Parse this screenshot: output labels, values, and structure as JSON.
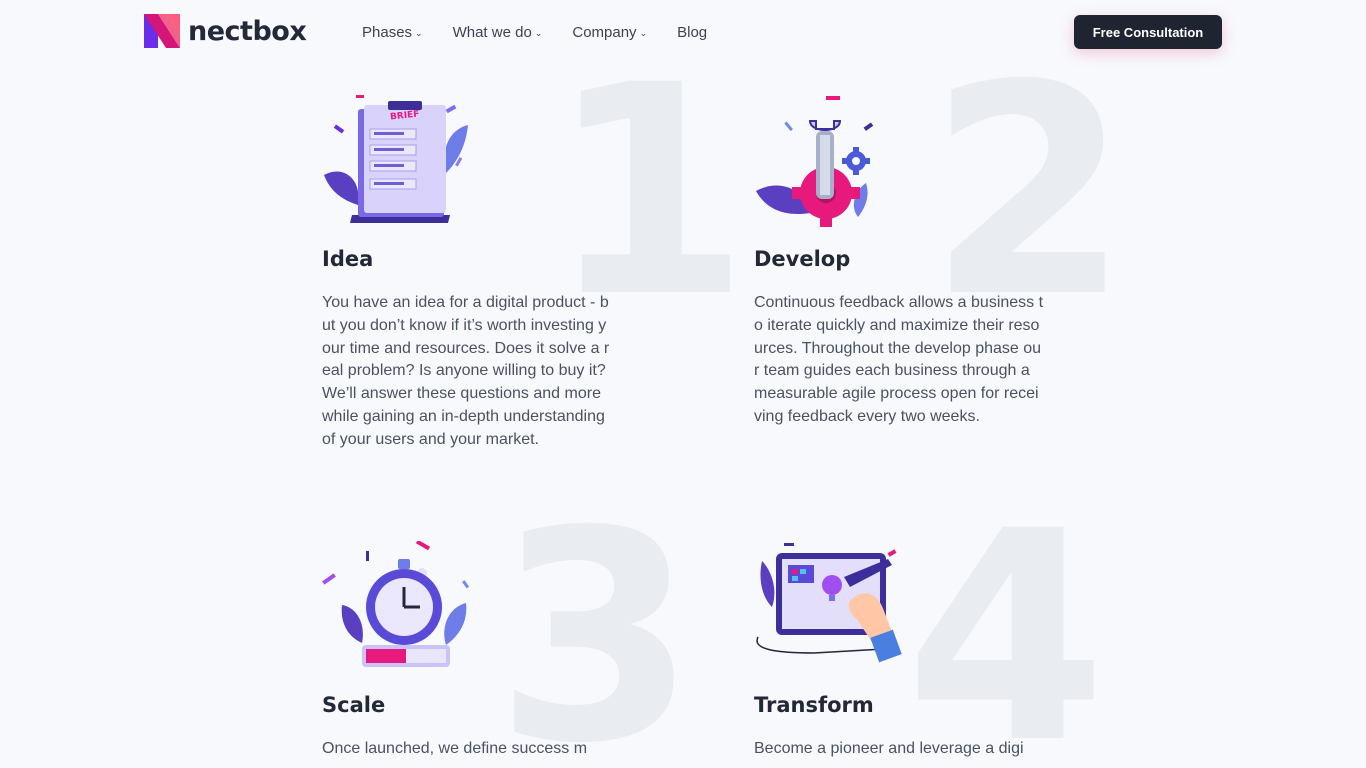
{
  "header": {
    "logo_text": "nectbox",
    "nav": [
      {
        "label": "Phases",
        "has_dropdown": true
      },
      {
        "label": "What we do",
        "has_dropdown": true
      },
      {
        "label": "Company",
        "has_dropdown": true
      },
      {
        "label": "Blog",
        "has_dropdown": false
      }
    ],
    "cta_label": "Free Consultation",
    "chevron_glyph": "⌄"
  },
  "phases": [
    {
      "number": "1",
      "title": "Idea",
      "icon": "brief-document-icon",
      "illus_label": "BRIEF",
      "text": "You have an idea for a digital product - but you don’t know if it’s worth investing your time and resources. Does it solve a real problem? Is anyone willing to buy it? We’ll answer these questions and more while gaining an in-depth understanding of your users and your market."
    },
    {
      "number": "2",
      "title": "Develop",
      "icon": "wrench-gear-icon",
      "text": "Continuous feedback allows a business to iterate quickly and maximize their resources. Throughout the develop phase our team guides each business through a measurable agile process open for receiving feedback every two weeks."
    },
    {
      "number": "3",
      "title": "Scale",
      "icon": "stopwatch-icon",
      "text": "Once launched, we define success m"
    },
    {
      "number": "4",
      "title": "Transform",
      "icon": "design-tablet-icon",
      "text": "Become a pioneer and leverage a digi"
    }
  ],
  "colors": {
    "background": "#f7f9fc",
    "button_dark": "#1f2431",
    "accent_pink": "#e8197d",
    "accent_purple": "#7b4ee0",
    "number_watermark": "#e9ecf1"
  }
}
